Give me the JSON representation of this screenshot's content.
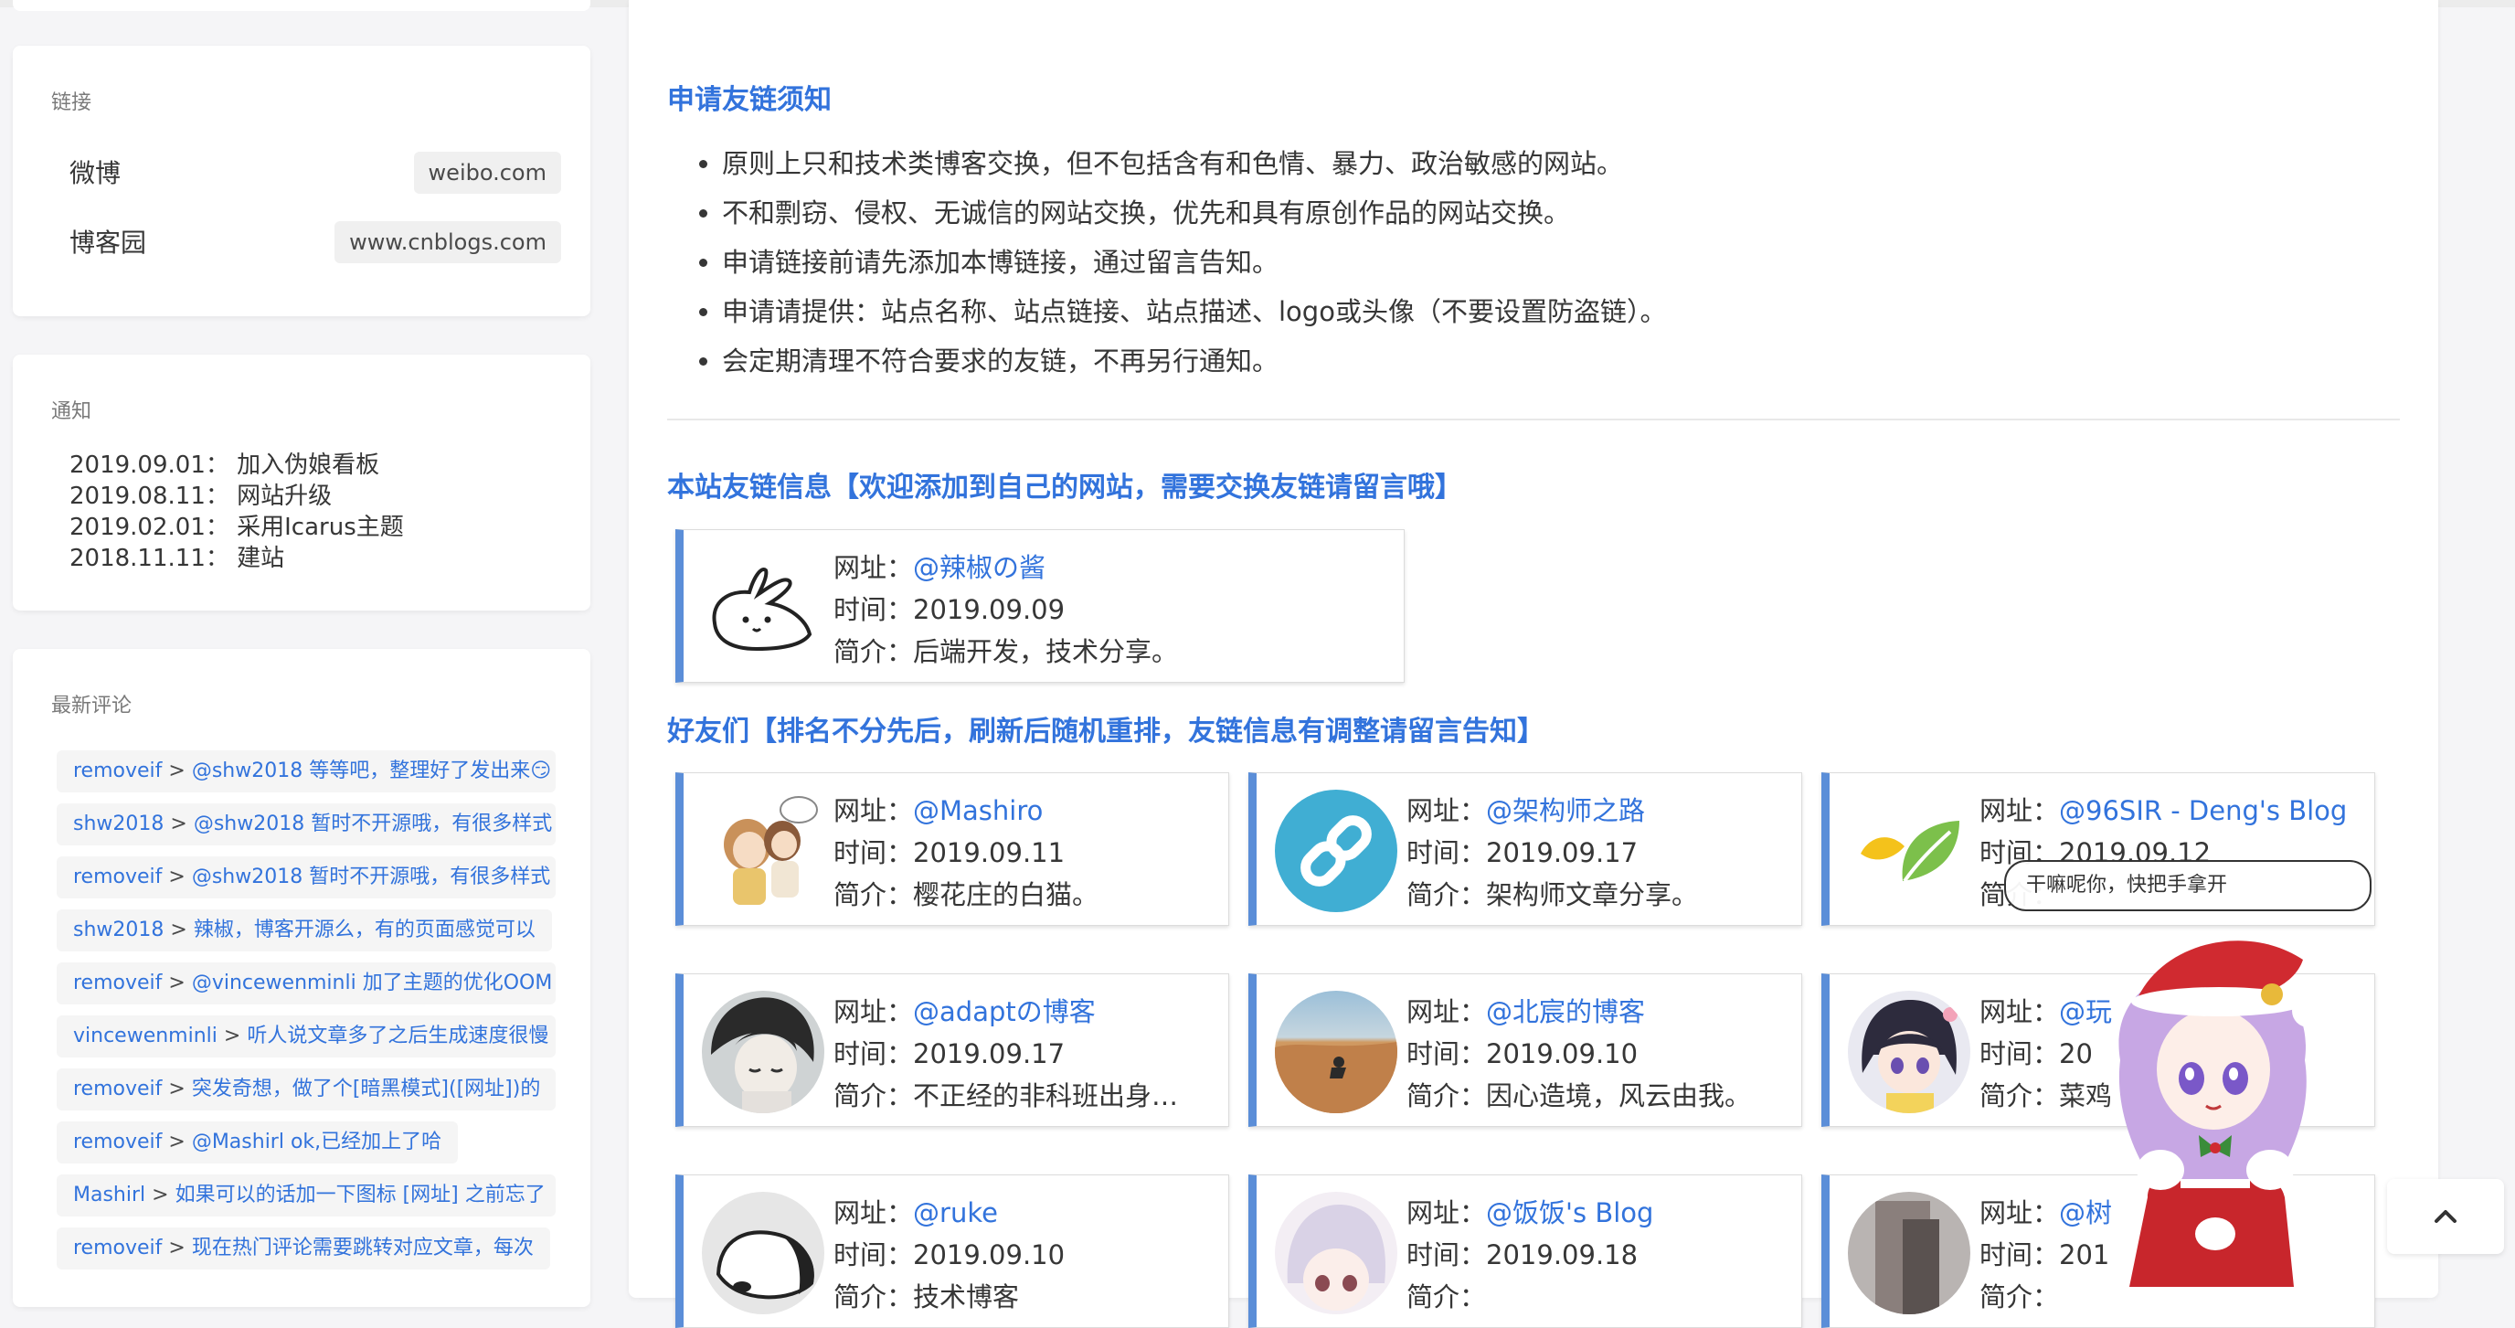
{
  "sidebar": {
    "links": {
      "title": "链接",
      "items": [
        {
          "name": "微博",
          "url": "weibo.com"
        },
        {
          "name": "博客园",
          "url": "www.cnblogs.com"
        }
      ]
    },
    "notice": {
      "title": "通知",
      "items": [
        {
          "date": "2019.09.01",
          "text": "加入伪娘看板"
        },
        {
          "date": "2019.08.11",
          "text": "网站升级"
        },
        {
          "date": "2019.02.01",
          "text": "采用Icarus主题"
        },
        {
          "date": "2018.11.11",
          "text": "建站"
        }
      ]
    },
    "comments": {
      "title": "最新评论",
      "sep": " > ",
      "items": [
        {
          "author": "removeif",
          "text": "@shw2018 等等吧，整理好了发出来😏"
        },
        {
          "author": "shw2018",
          "text": "@shw2018 暂时不开源哦，有很多样式"
        },
        {
          "author": "removeif",
          "text": "@shw2018 暂时不开源哦，有很多样式"
        },
        {
          "author": "shw2018",
          "text": "辣椒，博客开源么，有的页面感觉可以"
        },
        {
          "author": "removeif",
          "text": "@vincewenminli 加了主题的优化OOM"
        },
        {
          "author": "vincewenminli",
          "text": "听人说文章多了之后生成速度很慢"
        },
        {
          "author": "removeif",
          "text": "突发奇想，做了个[暗黑模式]([网址])的"
        },
        {
          "author": "removeif",
          "text": "@Mashirl ok,已经加上了哈"
        },
        {
          "author": "Mashirl",
          "text": "如果可以的话加一下图标 [网址] 之前忘了"
        },
        {
          "author": "removeif",
          "text": "现在热门评论需要跳转对应文章，每次"
        }
      ]
    }
  },
  "main": {
    "rules_heading": "申请友链须知",
    "rules": [
      "原则上只和技术类博客交换，但不包括含有和色情、暴力、政治敏感的网站。",
      "不和剽窃、侵权、无诚信的网站交换，优先和具有原创作品的网站交换。",
      "申请链接前请先添加本博链接，通过留言告知。",
      "申请请提供：站点名称、站点链接、站点描述、logo或头像（不要设置防盗链）。",
      "会定期清理不符合要求的友链，不再另行通知。"
    ],
    "site_heading": "本站友链信息【欢迎添加到自己的网站，需要交换友链请留言哦】",
    "friends_heading": "好友们【排名不分先后，刷新后随机重排，友链信息有调整请留言告知】",
    "labels": {
      "url": "网址：",
      "time": "时间：",
      "desc": "简介："
    },
    "site_card": {
      "name": "@辣椒の酱",
      "time": "2019.09.09",
      "desc": "后端开发，技术分享。"
    },
    "friends": [
      {
        "name": "@Mashiro",
        "time": "2019.09.11",
        "desc": "樱花庄的白猫。"
      },
      {
        "name": "@架构师之路",
        "time": "2019.09.17",
        "desc": "架构师文章分享。"
      },
      {
        "name": "@96SIR - Deng's Blog",
        "time": "2019.09.12",
        "desc": ""
      },
      {
        "name": "@adaptの博客",
        "time": "2019.09.17",
        "desc": "不正经的非科班出身…"
      },
      {
        "name": "@北宸的博客",
        "time": "2019.09.10",
        "desc": "因心造境，风云由我。"
      },
      {
        "name": "@玩",
        "time": "20",
        "desc": "菜鸡"
      },
      {
        "name": "@ruke",
        "time": "2019.09.10",
        "desc": "技术博客"
      },
      {
        "name": "@饭饭's Blog",
        "time": "2019.09.18",
        "desc": ""
      },
      {
        "name": "@树",
        "time": "201",
        "desc": ""
      }
    ],
    "mascot_bubble": "干嘛呢你，快把手拿开",
    "back_to_top_icon": "chevron-up-icon"
  }
}
